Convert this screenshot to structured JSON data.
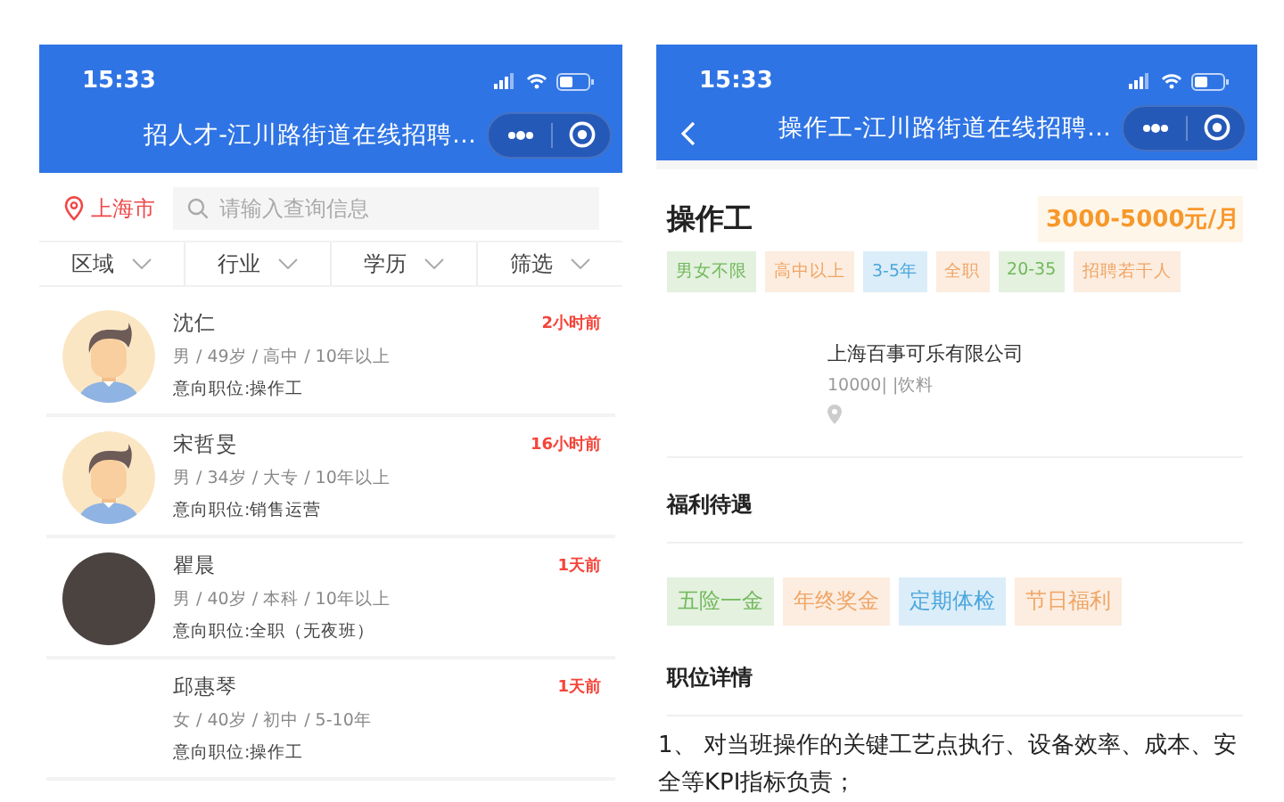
{
  "left": {
    "status_bar": {
      "time": "15:33"
    },
    "nav": {
      "title": "招人才-江川路街道在线招聘…"
    },
    "location": "上海市",
    "search": {
      "placeholder": "请输入查询信息"
    },
    "filters": [
      {
        "label": "区域"
      },
      {
        "label": "行业"
      },
      {
        "label": "学历"
      },
      {
        "label": "筛选"
      }
    ],
    "candidates": [
      {
        "kind": "cartoon",
        "name": "沈仁",
        "time": "2小时前",
        "details": "男 / 49岁 / 高中 / 10年以上",
        "intent": "意向职位:操作工"
      },
      {
        "kind": "cartoon",
        "name": "宋哲旻",
        "time": "16小时前",
        "details": "男 / 34岁 / 大专 / 10年以上",
        "intent": "意向职位:销售运营"
      },
      {
        "kind": "photo",
        "name": "瞿晨",
        "time": "1天前",
        "details": "男 / 40岁 / 本科 / 10年以上",
        "intent": "意向职位:全职（无夜班）"
      },
      {
        "kind": "none",
        "name": "邱惠琴",
        "time": "1天前",
        "details": "女 / 40岁 / 初中 / 5-10年",
        "intent": "意向职位:操作工"
      }
    ]
  },
  "right": {
    "status_bar": {
      "time": "15:33"
    },
    "nav": {
      "title": "操作工-江川路街道在线招聘…"
    },
    "job": {
      "title": "操作工",
      "salary": "3000-5000元/月",
      "tags": [
        {
          "label": "男女不限",
          "color": "#72b85c"
        },
        {
          "label": "高中以上",
          "color": "#f0a565"
        },
        {
          "label": "3-5年",
          "color": "#4ba6dd"
        },
        {
          "label": "全职",
          "color": "#f0a565"
        },
        {
          "label": "20-35",
          "color": "#72b85c"
        },
        {
          "label": "招聘若干人",
          "color": "#f0a565"
        }
      ]
    },
    "company": {
      "name": "上海百事可乐有限公司",
      "info": "10000| |饮料"
    },
    "benefits": {
      "heading": "福利待遇",
      "tags": [
        {
          "label": "五险一金",
          "color": "#72b85c"
        },
        {
          "label": "年终奖金",
          "color": "#f0a565"
        },
        {
          "label": "定期体检",
          "color": "#4ba6dd"
        },
        {
          "label": "节日福利",
          "color": "#f0a565"
        }
      ]
    },
    "description": {
      "heading": "职位详情",
      "text": "1、 对当班操作的关键工艺点执行、设备效率、成本、安全等KPI指标负责；"
    }
  }
}
